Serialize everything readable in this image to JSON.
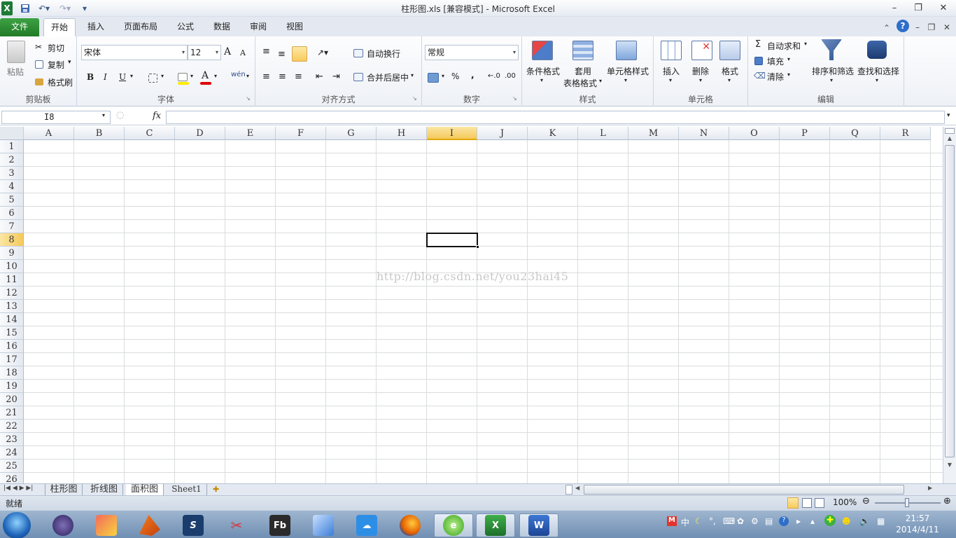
{
  "window": {
    "title": "柱形图.xls  [兼容模式] - Microsoft Excel",
    "app_icon": "X"
  },
  "ribbon_tabs": [
    "文件",
    "开始",
    "插入",
    "页面布局",
    "公式",
    "数据",
    "审阅",
    "视图"
  ],
  "clipboard": {
    "paste": "粘贴",
    "cut": "剪切",
    "copy": "复制",
    "format_painter": "格式刷",
    "label": "剪贴板"
  },
  "font": {
    "name": "宋体",
    "size": "12",
    "label": "字体",
    "bold": "B",
    "italic": "I",
    "underline": "U",
    "grow": "A",
    "shrink": "A",
    "phonetic": "wén",
    "font_color_glyph": "A"
  },
  "alignment": {
    "wrap": "自动换行",
    "merge": "合并后居中",
    "label": "对齐方式"
  },
  "number": {
    "format": "常规",
    "percent": "%",
    "comma": ",",
    "label": "数字"
  },
  "styles": {
    "conditional": "条件格式",
    "table_line1": "套用",
    "table_line2": "表格格式",
    "cell_styles": "单元格样式",
    "label": "样式"
  },
  "cells": {
    "insert": "插入",
    "delete": "删除",
    "format": "格式",
    "label": "单元格"
  },
  "editing": {
    "autosum": "自动求和",
    "sigma": "Σ",
    "fill": "填充",
    "clear": "清除",
    "sort": "排序和筛选",
    "find": "查找和选择",
    "label": "编辑"
  },
  "formula_bar": {
    "name_box": "I8",
    "fx": "fx"
  },
  "columns": [
    "A",
    "B",
    "C",
    "D",
    "E",
    "F",
    "G",
    "H",
    "I",
    "J",
    "K",
    "L",
    "M",
    "N",
    "O",
    "P",
    "Q",
    "R"
  ],
  "rows": [
    "1",
    "2",
    "3",
    "4",
    "5",
    "6",
    "7",
    "8",
    "9",
    "10",
    "11",
    "12",
    "13",
    "14",
    "15",
    "16",
    "17",
    "18",
    "19",
    "20",
    "21",
    "22",
    "23",
    "24",
    "25",
    "26"
  ],
  "selected": {
    "column": "I",
    "row": "8"
  },
  "watermark": "http://blog.csdn.net/you23hai45",
  "sheets": [
    "柱形图",
    "折线图",
    "面积图",
    "Sheet1"
  ],
  "active_sheet": "面积图",
  "status": {
    "ready": "就绪",
    "zoom": "100%"
  },
  "taskbar": {
    "time": "21:57",
    "date": "2014/4/11",
    "ime": "中",
    "fb_label": "Fb",
    "word_label": "W",
    "excel_label": "X"
  }
}
